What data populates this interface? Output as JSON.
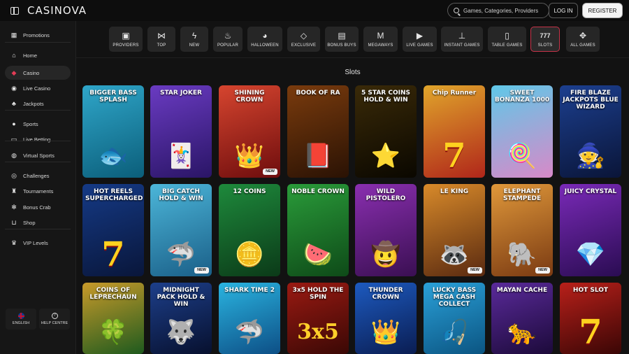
{
  "header": {
    "logo": "CASINOVA",
    "search_placeholder": "Games, Categories, Providers",
    "login_label": "LOG IN",
    "register_label": "REGISTER"
  },
  "sidebar": {
    "items": [
      {
        "label": "Promotions",
        "icon": "gift-icon"
      },
      {
        "label": "Home",
        "icon": "home-icon"
      },
      {
        "label": "Casino",
        "icon": "cherry-icon",
        "active": true
      },
      {
        "label": "Live Casino",
        "icon": "chip-icon"
      },
      {
        "label": "Jackpots",
        "icon": "clover-icon"
      },
      {
        "label": "Sports",
        "icon": "ball-icon"
      },
      {
        "label": "Live Betting",
        "icon": "live-icon"
      },
      {
        "label": "Virtual Sports",
        "icon": "virtual-icon"
      },
      {
        "label": "Challenges",
        "icon": "target-icon"
      },
      {
        "label": "Tournaments",
        "icon": "trophy-icon"
      },
      {
        "label": "Bonus Crab",
        "icon": "crab-icon"
      },
      {
        "label": "Shop",
        "icon": "cart-icon"
      },
      {
        "label": "VIP Levels",
        "icon": "crown-icon"
      }
    ],
    "language_label": "ENGLISH",
    "help_label": "HELP CENTRE"
  },
  "categories": [
    {
      "label": "PROVIDERS",
      "icon": "providers-icon"
    },
    {
      "label": "TOP",
      "icon": "bowtie-icon"
    },
    {
      "label": "NEW",
      "icon": "bolt-icon"
    },
    {
      "label": "POPULAR",
      "icon": "flame-icon"
    },
    {
      "label": "HALLOWEEN",
      "icon": "pumpkin-icon"
    },
    {
      "label": "EXCLUSIVE",
      "icon": "diamond-icon"
    },
    {
      "label": "BONUS BUYS",
      "icon": "giftbox-icon"
    },
    {
      "label": "MEGAWAYS",
      "icon": "megaways-icon"
    },
    {
      "label": "LIVE GAMES",
      "icon": "play-icon"
    },
    {
      "label": "INSTANT GAMES",
      "icon": "joystick-icon"
    },
    {
      "label": "TABLE GAMES",
      "icon": "cards-icon"
    },
    {
      "label": "SLOTS",
      "icon": "seven-icon",
      "active": true
    },
    {
      "label": "ALL GAMES",
      "icon": "grid-icon"
    }
  ],
  "section_title": "Slots",
  "games": [
    {
      "title": "BIGGER BASS SPLASH",
      "bg1": "#2fa6c9",
      "bg2": "#0b5e7a",
      "art": "🐟",
      "new": false
    },
    {
      "title": "STAR JOKER",
      "bg1": "#6a3bc2",
      "bg2": "#2a1566",
      "art": "🃏",
      "new": false
    },
    {
      "title": "SHINING CROWN",
      "bg1": "#d6452f",
      "bg2": "#6e0d0d",
      "art": "👑",
      "new": true,
      "badge": "NEW"
    },
    {
      "title": "BOOK OF RA",
      "bg1": "#7a3b0d",
      "bg2": "#2a1204",
      "art": "📕",
      "new": false
    },
    {
      "title": "5 STAR COINS HOLD & WIN",
      "bg1": "#3a2a08",
      "bg2": "#0a0700",
      "art": "⭐",
      "new": false
    },
    {
      "title": "Chip Runner",
      "bg1": "#e0a52b",
      "bg2": "#b0261a",
      "art": "7",
      "new": false
    },
    {
      "title": "SWEET BONANZA 1000",
      "bg1": "#5fc8e8",
      "bg2": "#d889c8",
      "art": "🍭",
      "new": false
    },
    {
      "title": "FIRE BLAZE JACKPOTS BLUE WIZARD",
      "bg1": "#1c3f8f",
      "bg2": "#0a1538",
      "art": "🧙",
      "new": false
    },
    {
      "title": "HOT REELS SUPERCHARGED",
      "bg1": "#153a86",
      "bg2": "#09163a",
      "art": "7",
      "new": false
    },
    {
      "title": "BIG CATCH HOLD & WIN",
      "bg1": "#4cb6d9",
      "bg2": "#1a5f88",
      "art": "🦈",
      "new": true,
      "badge": "NEW"
    },
    {
      "title": "12 COINS",
      "bg1": "#1e8a3c",
      "bg2": "#0b3a18",
      "art": "🪙",
      "new": false
    },
    {
      "title": "NOBLE CROWN",
      "bg1": "#2a9c3a",
      "bg2": "#0e4a18",
      "art": "🍉",
      "new": false
    },
    {
      "title": "WILD PISTOLERO",
      "bg1": "#8a2fb0",
      "bg2": "#3a0f52",
      "art": "🤠",
      "new": false
    },
    {
      "title": "LE KING",
      "bg1": "#d88a2a",
      "bg2": "#5a2a10",
      "art": "🦝",
      "new": true,
      "badge": "NEW"
    },
    {
      "title": "ELEPHANT STAMPEDE",
      "bg1": "#e0983a",
      "bg2": "#7a3a12",
      "art": "🐘",
      "new": true,
      "badge": "NEW"
    },
    {
      "title": "JUICY CRYSTAL",
      "bg1": "#7a2ab8",
      "bg2": "#2a0c52",
      "art": "💎",
      "new": false
    },
    {
      "title": "COINS OF LEPRECHAUN",
      "bg1": "#c89a2a",
      "bg2": "#1e5a1e",
      "art": "🍀",
      "new": false
    },
    {
      "title": "MIDNIGHT PACK HOLD & WIN",
      "bg1": "#1d3f8a",
      "bg2": "#07102e",
      "art": "🐺",
      "new": false
    },
    {
      "title": "SHARK TIME 2",
      "bg1": "#2ab4e0",
      "bg2": "#0d4f86",
      "art": "🦈",
      "new": false
    },
    {
      "title": "3x5 HOLD THE SPIN",
      "bg1": "#9a1a12",
      "bg2": "#3a0805",
      "art": "3x5",
      "new": false
    },
    {
      "title": "THUNDER CROWN",
      "bg1": "#1d5abf",
      "bg2": "#0a1d52",
      "art": "👑",
      "new": false
    },
    {
      "title": "LUCKY BASS MEGA CASH COLLECT",
      "bg1": "#2aa0d8",
      "bg2": "#0b5582",
      "art": "🎣",
      "new": false
    },
    {
      "title": "MAYAN CACHE",
      "bg1": "#5a2a9a",
      "bg2": "#1c0a3a",
      "art": "🐆",
      "new": false
    },
    {
      "title": "HOT SLOT",
      "bg1": "#b8201a",
      "bg2": "#3a0605",
      "art": "7",
      "new": false
    }
  ]
}
